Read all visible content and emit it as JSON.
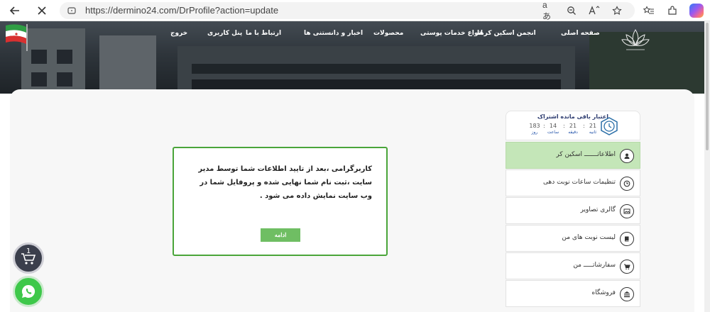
{
  "browser": {
    "url": "https://dermino24.com/DrProfile?action=update",
    "read_aloud_label": "aあ"
  },
  "header": {
    "nav": [
      {
        "id": "home",
        "label": "صفحه اصلی"
      },
      {
        "id": "association",
        "label": "انجمن اسکین کرها"
      },
      {
        "id": "skin-services",
        "label": "انواع خدمات پوستی"
      },
      {
        "id": "products",
        "label": "محصولات"
      },
      {
        "id": "news",
        "label": "اخبار و دانستنی ها"
      },
      {
        "id": "contact",
        "label": "ارتباط با ما"
      },
      {
        "id": "panel",
        "label": "پنل کاربری"
      },
      {
        "id": "logout",
        "label": "خروج"
      }
    ]
  },
  "subscription": {
    "title": "اعتبار باقی مانده اشتراک",
    "countdown": [
      {
        "value": "21",
        "label": "ثانیه"
      },
      {
        "value": "21",
        "label": "دقیقه"
      },
      {
        "value": "14",
        "label": "ساعت"
      },
      {
        "value": "183",
        "label": "روز"
      }
    ],
    "separator": ":"
  },
  "sidebar": {
    "items": [
      {
        "label": "اطلاعاتـــــــ اسکین کر",
        "icon": "user-badge-icon",
        "active": true
      },
      {
        "label": "تنظیمات ساعات نوبت دهی",
        "icon": "clock-icon",
        "active": false
      },
      {
        "label": "گالری تصاویر",
        "icon": "image-icon",
        "active": false
      },
      {
        "label": "لیست نوبت های من",
        "icon": "book-icon",
        "active": false
      },
      {
        "label": "سفارشاتـــــ من",
        "icon": "cart-icon",
        "active": false
      },
      {
        "label": "فروشگاه",
        "icon": "bank-icon",
        "active": false
      }
    ]
  },
  "dialog": {
    "message": "کاربرگرامی ،بعد از تایید اطلاعات شما توسط مدیر سایت ،ثبت نام شما نهایی شده و پروفایل شما در وب سایت نمایش داده می شود .",
    "button_label": "ادامه"
  },
  "floating": {
    "cart_count": "1"
  },
  "colors": {
    "accent_green": "#4aa53a",
    "button_green": "#6fbe63",
    "active_item_bg": "#c4e6b8",
    "title_blue": "#2b3a6e"
  }
}
